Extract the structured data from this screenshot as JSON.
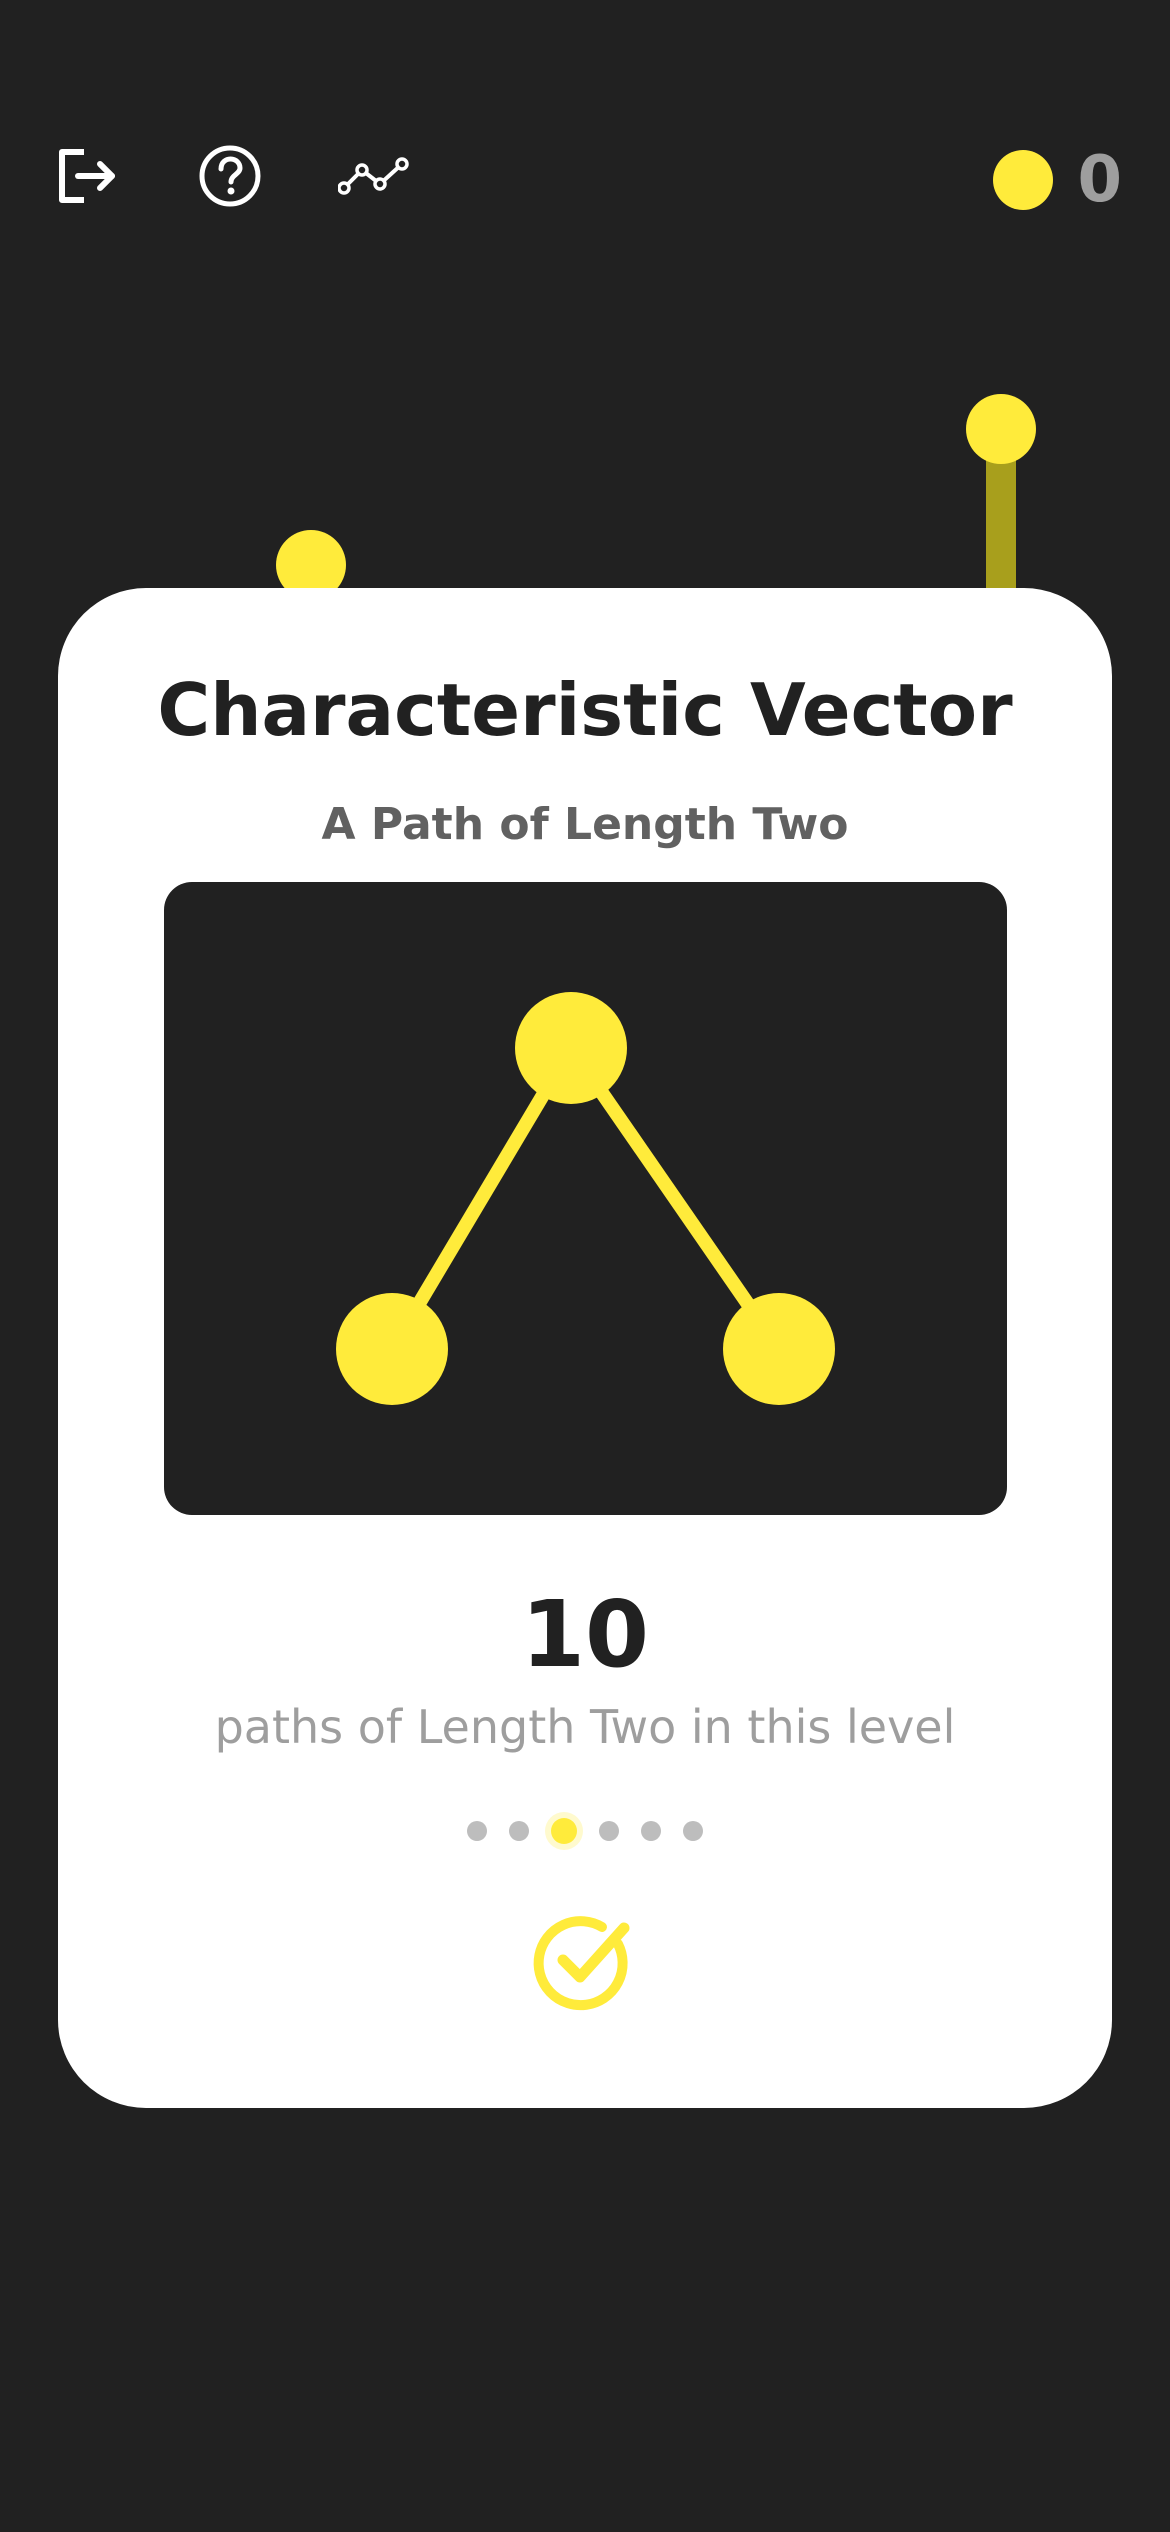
{
  "toolbar": {
    "exit_icon": "exit-icon",
    "help_icon": "help-icon",
    "stats_icon": "stats-graph-icon"
  },
  "coins": {
    "count": "0",
    "icon": "coin-icon"
  },
  "card": {
    "title": "Characteristic Vector",
    "subtitle": "A Path of Length Two",
    "count": "10",
    "caption": "paths of Length Two in this level",
    "pager": {
      "total": 6,
      "active_index": 2
    },
    "confirm_icon": "check-circle-icon"
  },
  "colors": {
    "background": "#212121",
    "accent": "#FFEB3B",
    "card": "#ffffff",
    "muted": "#9e9e9e"
  }
}
